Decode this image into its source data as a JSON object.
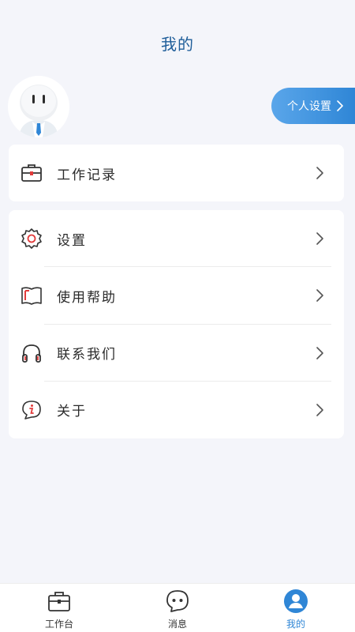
{
  "header": {
    "title": "我的"
  },
  "profile": {
    "settings_button": "个人设置"
  },
  "menu_group1": [
    {
      "label": "工作记录",
      "icon": "briefcase-icon"
    }
  ],
  "menu_group2": [
    {
      "label": "设置",
      "icon": "gear-icon"
    },
    {
      "label": "使用帮助",
      "icon": "book-icon"
    },
    {
      "label": "联系我们",
      "icon": "headphones-icon"
    },
    {
      "label": "关于",
      "icon": "info-icon"
    }
  ],
  "tabbar": {
    "tabs": [
      {
        "label": "工作台",
        "icon": "briefcase-icon"
      },
      {
        "label": "消息",
        "icon": "chat-icon"
      },
      {
        "label": "我的",
        "icon": "user-icon",
        "active": true
      }
    ]
  },
  "colors": {
    "accent": "#2f86d6",
    "title": "#1e5d99",
    "background": "#f4f5fa",
    "icon_red": "#e23b3b"
  }
}
